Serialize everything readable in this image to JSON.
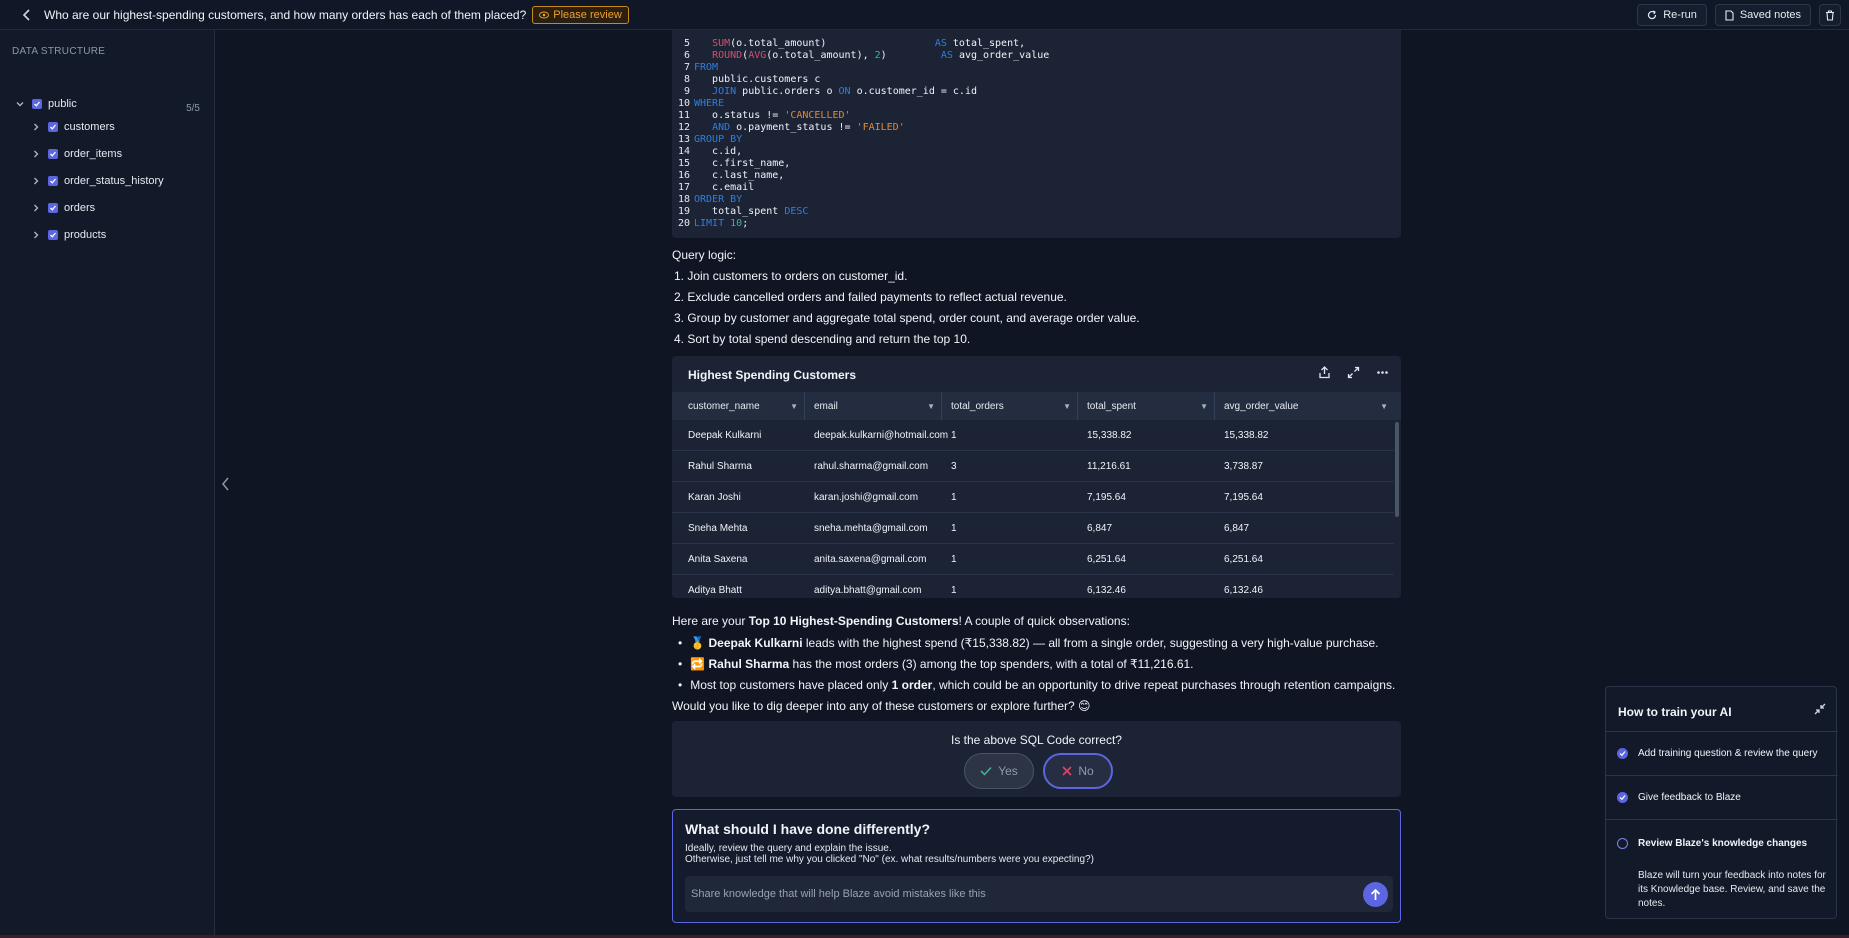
{
  "header": {
    "question": "Who are our highest-spending customers, and how many orders has each of them placed?",
    "review_badge": "Please review",
    "rerun_label": "Re-run",
    "saved_notes_label": "Saved notes"
  },
  "sidebar": {
    "title": "DATA STRUCTURE",
    "schema": {
      "label": "public",
      "count": "5/5"
    },
    "tables": [
      "customers",
      "order_items",
      "order_status_history",
      "orders",
      "products"
    ]
  },
  "code": {
    "lines": [
      {
        "n": "5",
        "segments": [
          {
            "t": "   ",
            "c": "code-txt"
          },
          {
            "t": "SUM",
            "c": "fn"
          },
          {
            "t": "(o.total_amount)",
            "c": "code-txt"
          },
          {
            "t": "                  ",
            "c": "code-txt"
          },
          {
            "t": "AS",
            "c": "kw"
          },
          {
            "t": " total_spent,",
            "c": "code-txt"
          }
        ]
      },
      {
        "n": "6",
        "segments": [
          {
            "t": "   ",
            "c": "code-txt"
          },
          {
            "t": "ROUND",
            "c": "fn"
          },
          {
            "t": "(",
            "c": "code-txt"
          },
          {
            "t": "AVG",
            "c": "fn"
          },
          {
            "t": "(o.total_amount), ",
            "c": "code-txt"
          },
          {
            "t": "2",
            "c": "num"
          },
          {
            "t": ")         ",
            "c": "code-txt"
          },
          {
            "t": "AS",
            "c": "kw"
          },
          {
            "t": " avg_order_value",
            "c": "code-txt"
          }
        ]
      },
      {
        "n": "7",
        "segments": [
          {
            "t": "FROM",
            "c": "kw"
          }
        ]
      },
      {
        "n": "8",
        "segments": [
          {
            "t": "   public.customers c",
            "c": "code-txt"
          }
        ]
      },
      {
        "n": "9",
        "segments": [
          {
            "t": "   ",
            "c": "code-txt"
          },
          {
            "t": "JOIN",
            "c": "kw"
          },
          {
            "t": " public.orders o ",
            "c": "code-txt"
          },
          {
            "t": "ON",
            "c": "kw"
          },
          {
            "t": " o.customer_id = c.id",
            "c": "code-txt"
          }
        ]
      },
      {
        "n": "10",
        "segments": [
          {
            "t": "WHERE",
            "c": "kw"
          }
        ]
      },
      {
        "n": "11",
        "segments": [
          {
            "t": "   o.status != ",
            "c": "code-txt"
          },
          {
            "t": "'CANCELLED'",
            "c": "str"
          }
        ]
      },
      {
        "n": "12",
        "segments": [
          {
            "t": "   ",
            "c": "code-txt"
          },
          {
            "t": "AND",
            "c": "kw"
          },
          {
            "t": " o.payment_status != ",
            "c": "code-txt"
          },
          {
            "t": "'FAILED'",
            "c": "str"
          }
        ]
      },
      {
        "n": "13",
        "segments": [
          {
            "t": "GROUP BY",
            "c": "kw"
          }
        ]
      },
      {
        "n": "14",
        "segments": [
          {
            "t": "   c.id,",
            "c": "code-txt"
          }
        ]
      },
      {
        "n": "15",
        "segments": [
          {
            "t": "   c.first_name,",
            "c": "code-txt"
          }
        ]
      },
      {
        "n": "16",
        "segments": [
          {
            "t": "   c.last_name,",
            "c": "code-txt"
          }
        ]
      },
      {
        "n": "17",
        "segments": [
          {
            "t": "   c.email",
            "c": "code-txt"
          }
        ]
      },
      {
        "n": "18",
        "segments": [
          {
            "t": "ORDER BY",
            "c": "kw"
          }
        ]
      },
      {
        "n": "19",
        "segments": [
          {
            "t": "   total_spent ",
            "c": "code-txt"
          },
          {
            "t": "DESC",
            "c": "kw"
          }
        ]
      },
      {
        "n": "20",
        "segments": [
          {
            "t": "LIMIT",
            "c": "kw"
          },
          {
            "t": " ",
            "c": "code-txt"
          },
          {
            "t": "10",
            "c": "num"
          },
          {
            "t": ";",
            "c": "code-txt"
          }
        ]
      }
    ]
  },
  "query_logic": {
    "title": "Query logic:",
    "items": [
      "1. Join customers to orders on customer_id.",
      "2. Exclude cancelled orders and failed payments to reflect actual revenue.",
      "3. Group by customer and aggregate total spend, order count, and average order value.",
      "4. Sort by total spend descending and return the top 10."
    ]
  },
  "result_table": {
    "title": "Highest Spending Customers",
    "columns": [
      "customer_name",
      "email",
      "total_orders",
      "total_spent",
      "avg_order_value"
    ],
    "rows": [
      [
        "Deepak Kulkarni",
        "deepak.kulkarni@hotmail.com",
        "1",
        "15,338.82",
        "15,338.82"
      ],
      [
        "Rahul Sharma",
        "rahul.sharma@gmail.com",
        "3",
        "11,216.61",
        "3,738.87"
      ],
      [
        "Karan Joshi",
        "karan.joshi@gmail.com",
        "1",
        "7,195.64",
        "7,195.64"
      ],
      [
        "Sneha Mehta",
        "sneha.mehta@gmail.com",
        "1",
        "6,847",
        "6,847"
      ],
      [
        "Anita Saxena",
        "anita.saxena@gmail.com",
        "1",
        "6,251.64",
        "6,251.64"
      ],
      [
        "Aditya Bhatt",
        "aditya.bhatt@gmail.com",
        "1",
        "6,132.46",
        "6,132.46"
      ]
    ]
  },
  "observations": {
    "intro_pre": "Here are your ",
    "intro_bold": "Top 10 Highest-Spending Customers",
    "intro_post": "! A couple of quick observations:",
    "bullets": [
      {
        "emoji": "🥇",
        "bold": "Deepak Kulkarni",
        "text": " leads with the highest spend (₹15,338.82) — all from a single order, suggesting a very high-value purchase."
      },
      {
        "emoji": "🔁",
        "bold": "Rahul Sharma",
        "text": " has the most orders (3) among the top spenders, with a total of ₹11,216.61."
      },
      {
        "emoji": "",
        "pre": "Most top customers have placed only ",
        "bold": "1 order",
        "text": ", which could be an opportunity to drive repeat purchases through retention campaigns."
      }
    ],
    "ask": "Would you like to dig deeper into any of these customers or explore further? 😊"
  },
  "feedback": {
    "question": "Is the above SQL Code correct?",
    "yes_label": "Yes",
    "no_label": "No"
  },
  "diff": {
    "title": "What should I have done differently?",
    "line1": "Ideally, review the query and explain the issue.",
    "line2": "Otherwise, just tell me why you clicked \"No\" (ex. what results/numbers were you expecting?)",
    "placeholder": "Share knowledge that will help Blaze avoid mistakes like this"
  },
  "train_panel": {
    "title": "How to train your AI",
    "steps": [
      "Add training question & review the query",
      "Give feedback to Blaze",
      "Review Blaze's knowledge changes"
    ],
    "description": "Blaze will turn your feedback into notes for its Knowledge base. Review, and save the notes."
  },
  "colors": {
    "accent": "#5b66e0",
    "warning": "#f0a12a",
    "background": "#0f1523"
  }
}
